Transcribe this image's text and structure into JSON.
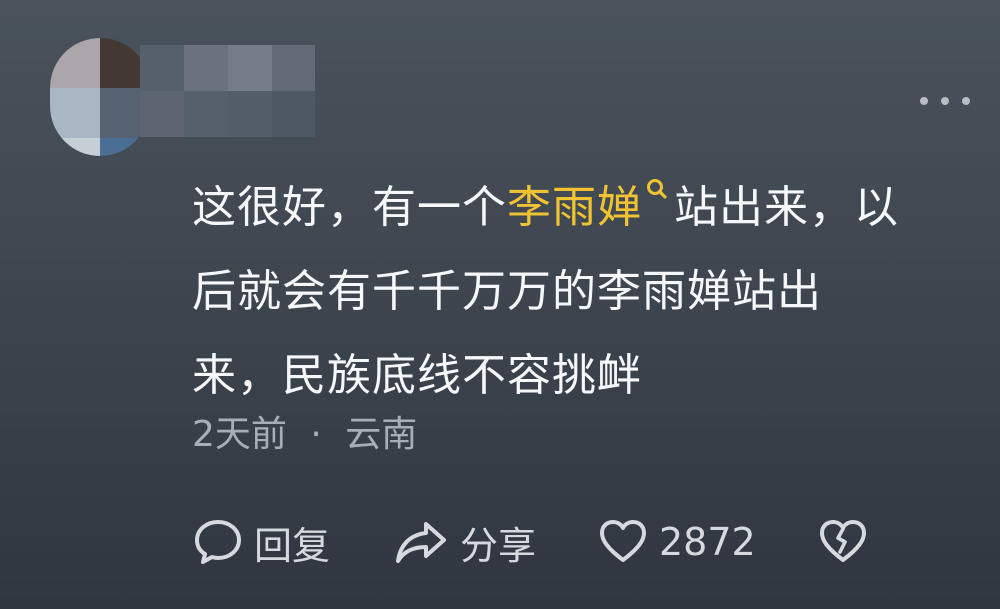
{
  "comment": {
    "text_line1_a": "这很好，有一个",
    "keyword": "李雨婵",
    "text_line1_b": "站出来，以",
    "text_line2": "后就会有千千万万的李雨婵站出",
    "text_line3": "来，民族底线不容挑衅",
    "time": "2天前",
    "separator": "·",
    "location": "云南"
  },
  "actions": {
    "reply_label": "回复",
    "share_label": "分享",
    "like_count": "2872"
  },
  "icons": {
    "more": "more-icon",
    "search": "search-icon",
    "reply": "reply-icon",
    "share": "share-icon",
    "like": "heart-icon",
    "dislike": "broken-heart-icon"
  },
  "colors": {
    "keyword": "#f1c232",
    "text": "#f6f7f8",
    "meta": "#a8aeb5"
  }
}
